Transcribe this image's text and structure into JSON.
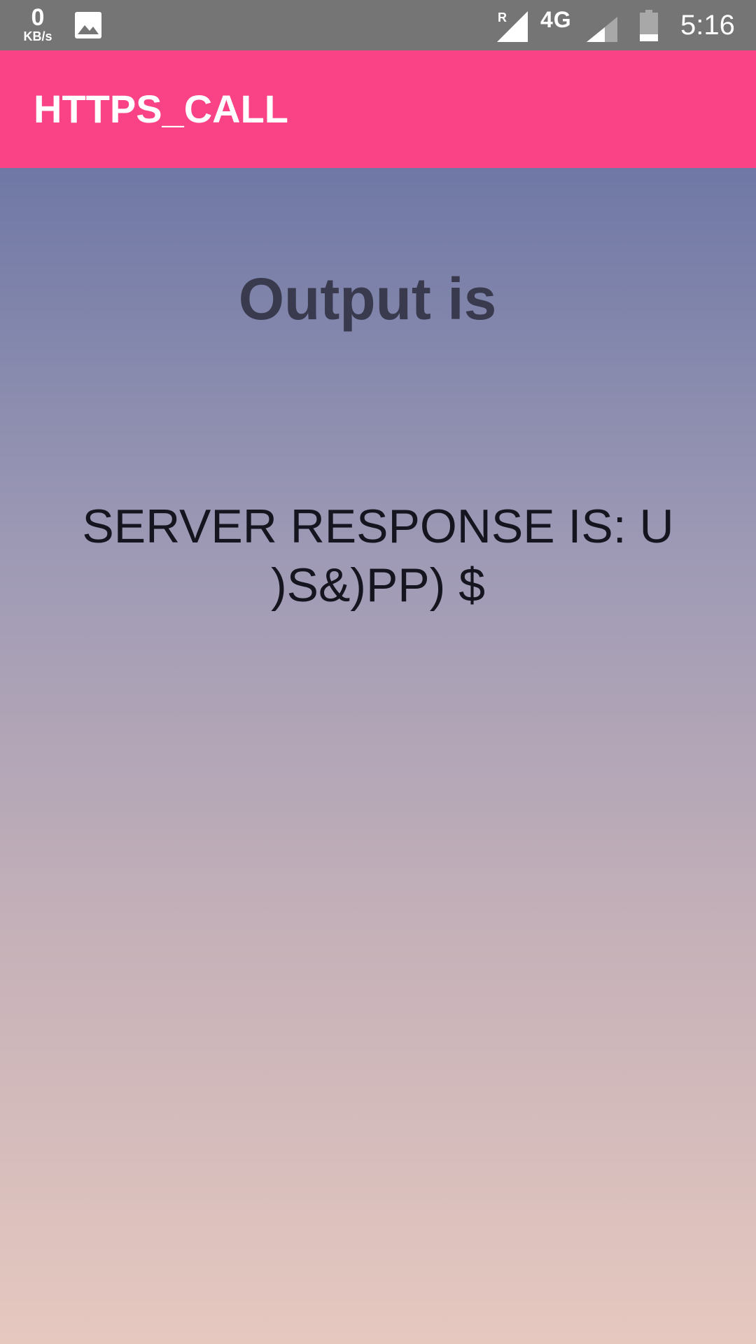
{
  "status_bar": {
    "net_speed_value": "0",
    "net_speed_unit": "KB/s",
    "roaming_label": "R",
    "network_type": "4G",
    "time": "5:16",
    "icons": [
      "gallery-icon",
      "roaming-signal-icon",
      "signal-icon",
      "battery-icon"
    ]
  },
  "app_bar": {
    "title": "HTTPS_CALL",
    "color": "#fa4286"
  },
  "content": {
    "output_label": "Output is",
    "server_response": "SERVER RESPONSE IS: U )S&)PP) $"
  },
  "colors": {
    "status_bar": "#757575",
    "gradient_top": "#6f78a5",
    "gradient_bottom": "#e6c8bf"
  }
}
